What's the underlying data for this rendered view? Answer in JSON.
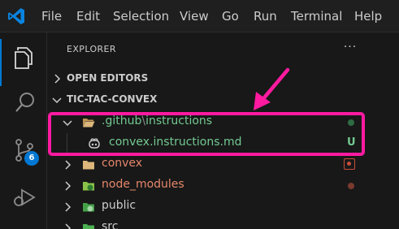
{
  "menu": {
    "items": [
      "File",
      "Edit",
      "Selection",
      "View",
      "Go",
      "Run",
      "Terminal",
      "Help"
    ]
  },
  "activity_bar": {
    "icons": [
      "explorer-icon",
      "search-icon",
      "source-control-icon",
      "run-debug-icon"
    ],
    "source_control_badge": "6",
    "accent": "#0078d4"
  },
  "explorer": {
    "title": "EXPLORER",
    "more_actions": "···",
    "open_editors_label": "OPEN EDITORS",
    "workspace_label": "TIC-TAC-CONVEX",
    "tree": [
      {
        "prefix": ".github",
        "separator": "\\",
        "suffix": "instructions",
        "kind": "folder",
        "color": "#73c991",
        "git": "dot",
        "git_color": "#2f6b43"
      },
      {
        "label": "convex.instructions.md",
        "kind": "file",
        "color": "#73c991",
        "git": "U",
        "git_color": "#73c991"
      },
      {
        "label": "convex",
        "kind": "folder",
        "color": "#e6876b",
        "git": "square",
        "git_color": "#c74e39"
      },
      {
        "label": "node_modules",
        "kind": "folder",
        "color": "#e6876b",
        "git": "dot",
        "git_color": "#7a3a2e"
      },
      {
        "label": "public",
        "kind": "folder",
        "color": "#cccccc"
      },
      {
        "label": "src",
        "kind": "folder",
        "color": "#cccccc"
      }
    ]
  },
  "annotation": {
    "highlight_color": "#ff1aa0"
  }
}
